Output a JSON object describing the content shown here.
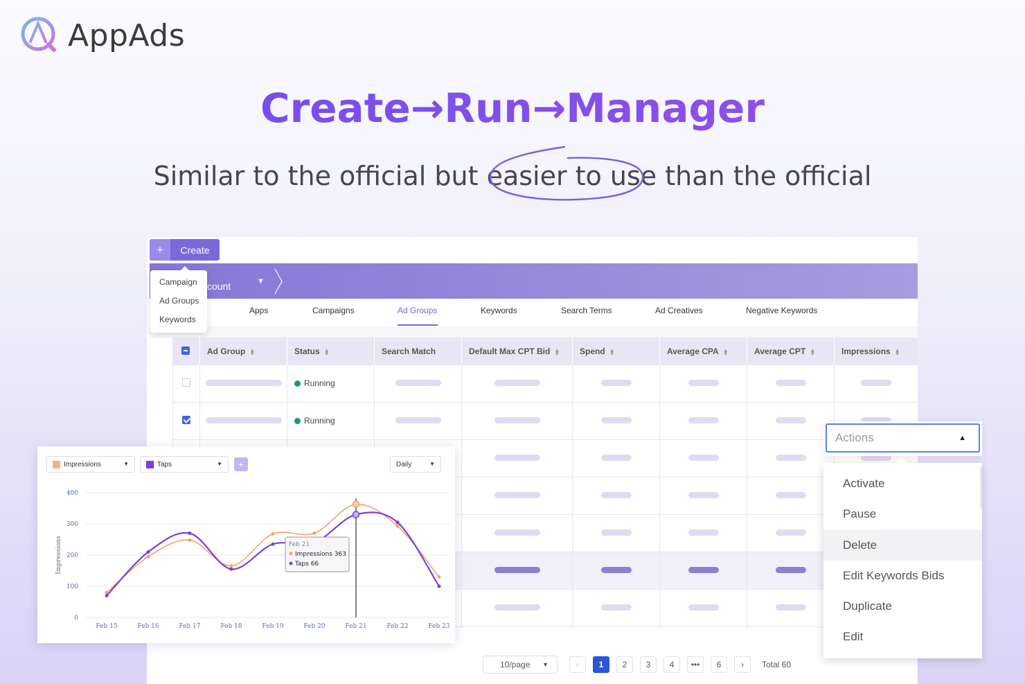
{
  "brand": {
    "name": "AppAds"
  },
  "headline": "Create→Run→Manager",
  "subline": {
    "before": "Similar to the official but ",
    "highlight": "easier to use",
    "after": " than the official"
  },
  "toolbar": {
    "create_label": "Create",
    "create_icon": "plus-icon"
  },
  "create_menu": [
    "Campaign",
    "Ad Groups",
    "Keywords"
  ],
  "account": {
    "label": "ccount"
  },
  "tabs": [
    {
      "label": "Apps",
      "active": false
    },
    {
      "label": "Campaigns",
      "active": false
    },
    {
      "label": "Ad Groups",
      "active": true
    },
    {
      "label": "Keywords",
      "active": false
    },
    {
      "label": "Search Terms",
      "active": false
    },
    {
      "label": "Ad Creatives",
      "active": false
    },
    {
      "label": "Negative Keywords",
      "active": false
    }
  ],
  "table": {
    "columns": [
      "Ad Group",
      "Status",
      "Search Match",
      "Default Max CPT Bid",
      "Spend",
      "Average CPA",
      "Average CPT",
      "Impressions"
    ],
    "sortable": [
      true,
      true,
      false,
      true,
      true,
      true,
      true,
      true
    ],
    "rows": [
      {
        "checked": false,
        "status": "Running"
      },
      {
        "checked": true,
        "status": "Running"
      },
      {
        "checked": false,
        "status": ""
      },
      {
        "checked": false,
        "status": ""
      },
      {
        "checked": false,
        "status": ""
      },
      {
        "checked": false,
        "status": "",
        "hover": true
      },
      {
        "checked": false,
        "status": ""
      }
    ]
  },
  "pagination": {
    "page_size": "10/page",
    "pages": [
      "1",
      "2",
      "3",
      "4",
      "•••",
      "6"
    ],
    "current": "1",
    "prev": "‹",
    "next": "›",
    "total": "Total 60"
  },
  "chart_controls": {
    "metric1": "Impressions",
    "metric2": "Taps",
    "add": "+",
    "period": "Daily"
  },
  "colors": {
    "impressions": "#f5a26a",
    "taps": "#7b3fd6",
    "accent": "#7667d6",
    "status_running": "#1a9a6b"
  },
  "chart_data": {
    "type": "line",
    "categories": [
      "Feb 15",
      "Feb 16",
      "Feb 17",
      "Feb 18",
      "Feb 19",
      "Feb 20",
      "Feb 21",
      "Feb 22",
      "Feb 23"
    ],
    "series": [
      {
        "name": "Impressions",
        "values": [
          80,
          195,
          248,
          165,
          268,
          270,
          363,
          293,
          130
        ]
      },
      {
        "name": "Taps",
        "values": [
          70,
          210,
          270,
          155,
          235,
          240,
          330,
          305,
          100
        ]
      }
    ],
    "ylabel": "Impressions",
    "yticks": [
      "0",
      "100",
      "200",
      "300",
      "400"
    ],
    "ylim": [
      0,
      400
    ],
    "tooltip": {
      "date": "Feb 21",
      "lines": [
        "Impressions 363",
        "Taps 66"
      ]
    }
  },
  "actions": {
    "placeholder": "Actions",
    "items": [
      "Activate",
      "Pause",
      "Delete",
      "Edit Keywords Bids",
      "Duplicate",
      "Edit"
    ],
    "hovered": "Delete"
  }
}
